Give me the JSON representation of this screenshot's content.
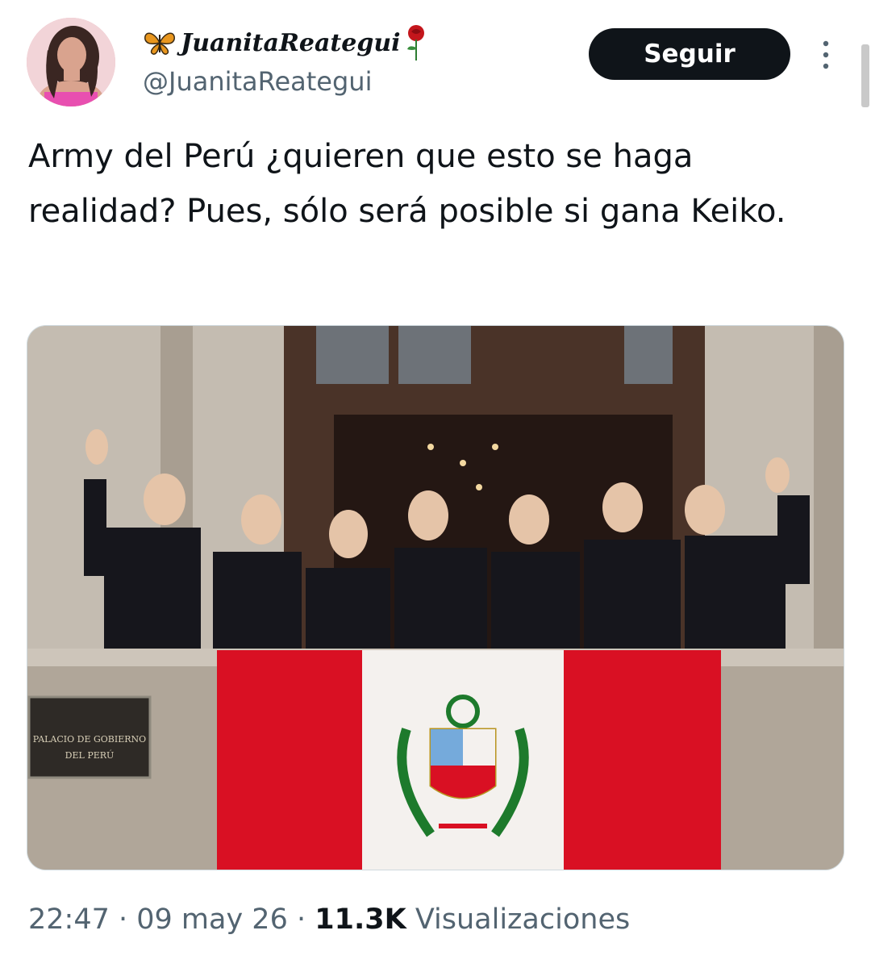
{
  "author": {
    "display_name": "JuanitaReategui",
    "handle": "@JuanitaReategui",
    "name_prefix_icon": "butterfly-icon",
    "name_suffix_icon": "rose-icon"
  },
  "follow_button": {
    "label": "Seguir"
  },
  "tweet": {
    "text": "Army del Perú ¿quieren que esto se haga realidad? Pues, sólo será posible si gana Keiko."
  },
  "photo": {
    "plaque_line1": "PALACIO DE GOBIERNO",
    "plaque_line2": "DEL PERÚ"
  },
  "meta": {
    "time": "22:47",
    "separator": " · ",
    "date": "09 may 26",
    "views_count": "11.3K",
    "views_label": " Visualizaciones"
  },
  "colors": {
    "text_primary": "#0f1419",
    "text_secondary": "#536471",
    "button_bg": "#0f1419",
    "flag_red": "#d91023"
  }
}
